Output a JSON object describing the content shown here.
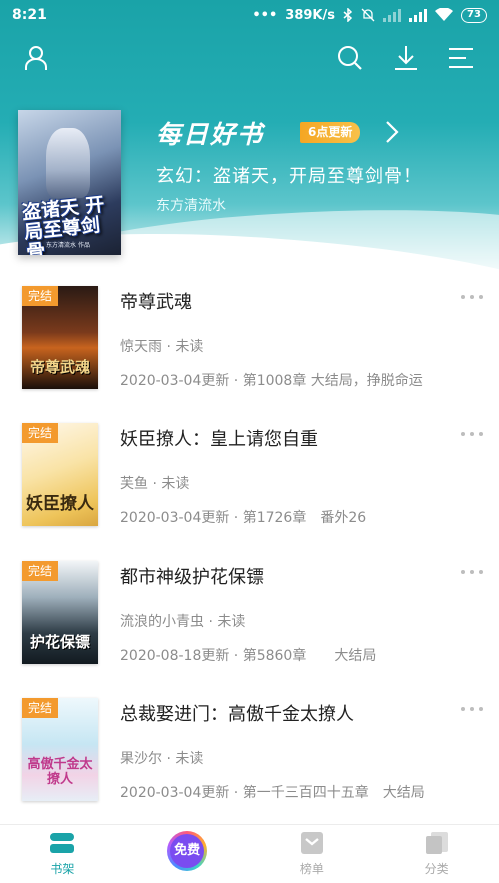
{
  "status_bar": {
    "time": "8:21",
    "network_speed": "389K/s",
    "battery": "73"
  },
  "top_bar": {
    "icons": [
      "user-icon",
      "search-icon",
      "download-icon",
      "menu-icon"
    ]
  },
  "daily_pick": {
    "title": "每日好书",
    "badge": "6点更新",
    "book_title": "玄幻：盗诸天，开局至尊剑骨！",
    "author": "东方清流水",
    "cover_text": "盗诸天 开局至尊剑骨",
    "cover_author": "东方清流水 作品"
  },
  "books": [
    {
      "tag": "完结",
      "title": "帝尊武魂",
      "meta": "惊天雨 · 未读",
      "update": "2020-03-04更新 · 第1008章 大结局，挣脱命运",
      "cover_text": "帝尊武魂",
      "cover_colors": [
        "#3a2218",
        "#7a3a1c",
        "#1a0f0a"
      ]
    },
    {
      "tag": "完结",
      "title": "妖臣撩人：皇上请您自重",
      "meta": "芙鱼 · 未读",
      "update": "2020-03-04更新 · 第1726章　番外26",
      "cover_text": "妖臣撩人",
      "cover_colors": [
        "#fff6e6",
        "#f7d98a",
        "#e8b84a"
      ]
    },
    {
      "tag": "完结",
      "title": "都市神级护花保镖",
      "meta": "流浪的小青虫 · 未读",
      "update": "2020-08-18更新 · 第5860章　　大结局",
      "cover_text": "护花保镖",
      "cover_colors": [
        "#e8eef2",
        "#6d7f8c",
        "#1b2730"
      ]
    },
    {
      "tag": "完结",
      "title": "总裁娶进门：高傲千金太撩人",
      "meta": "果沙尔 · 未读",
      "update": "2020-03-04更新 · 第一千三百四十五章　大结局",
      "cover_text": "高傲千金太撩人",
      "cover_colors": [
        "#eaf6fb",
        "#bfe2f0",
        "#f4d2e6"
      ]
    }
  ],
  "bottom_nav": [
    {
      "label": "书架",
      "icon": "bookshelf-icon",
      "active": true
    },
    {
      "label": "免费",
      "icon": "free-badge-icon",
      "active": false
    },
    {
      "label": "榜单",
      "icon": "ranking-icon",
      "active": false
    },
    {
      "label": "分类",
      "icon": "category-icon",
      "active": false
    }
  ],
  "colors": {
    "accent": "#1aa3a8",
    "tag_orange": "#f39a2e",
    "badge_orange": "#f5a623"
  }
}
